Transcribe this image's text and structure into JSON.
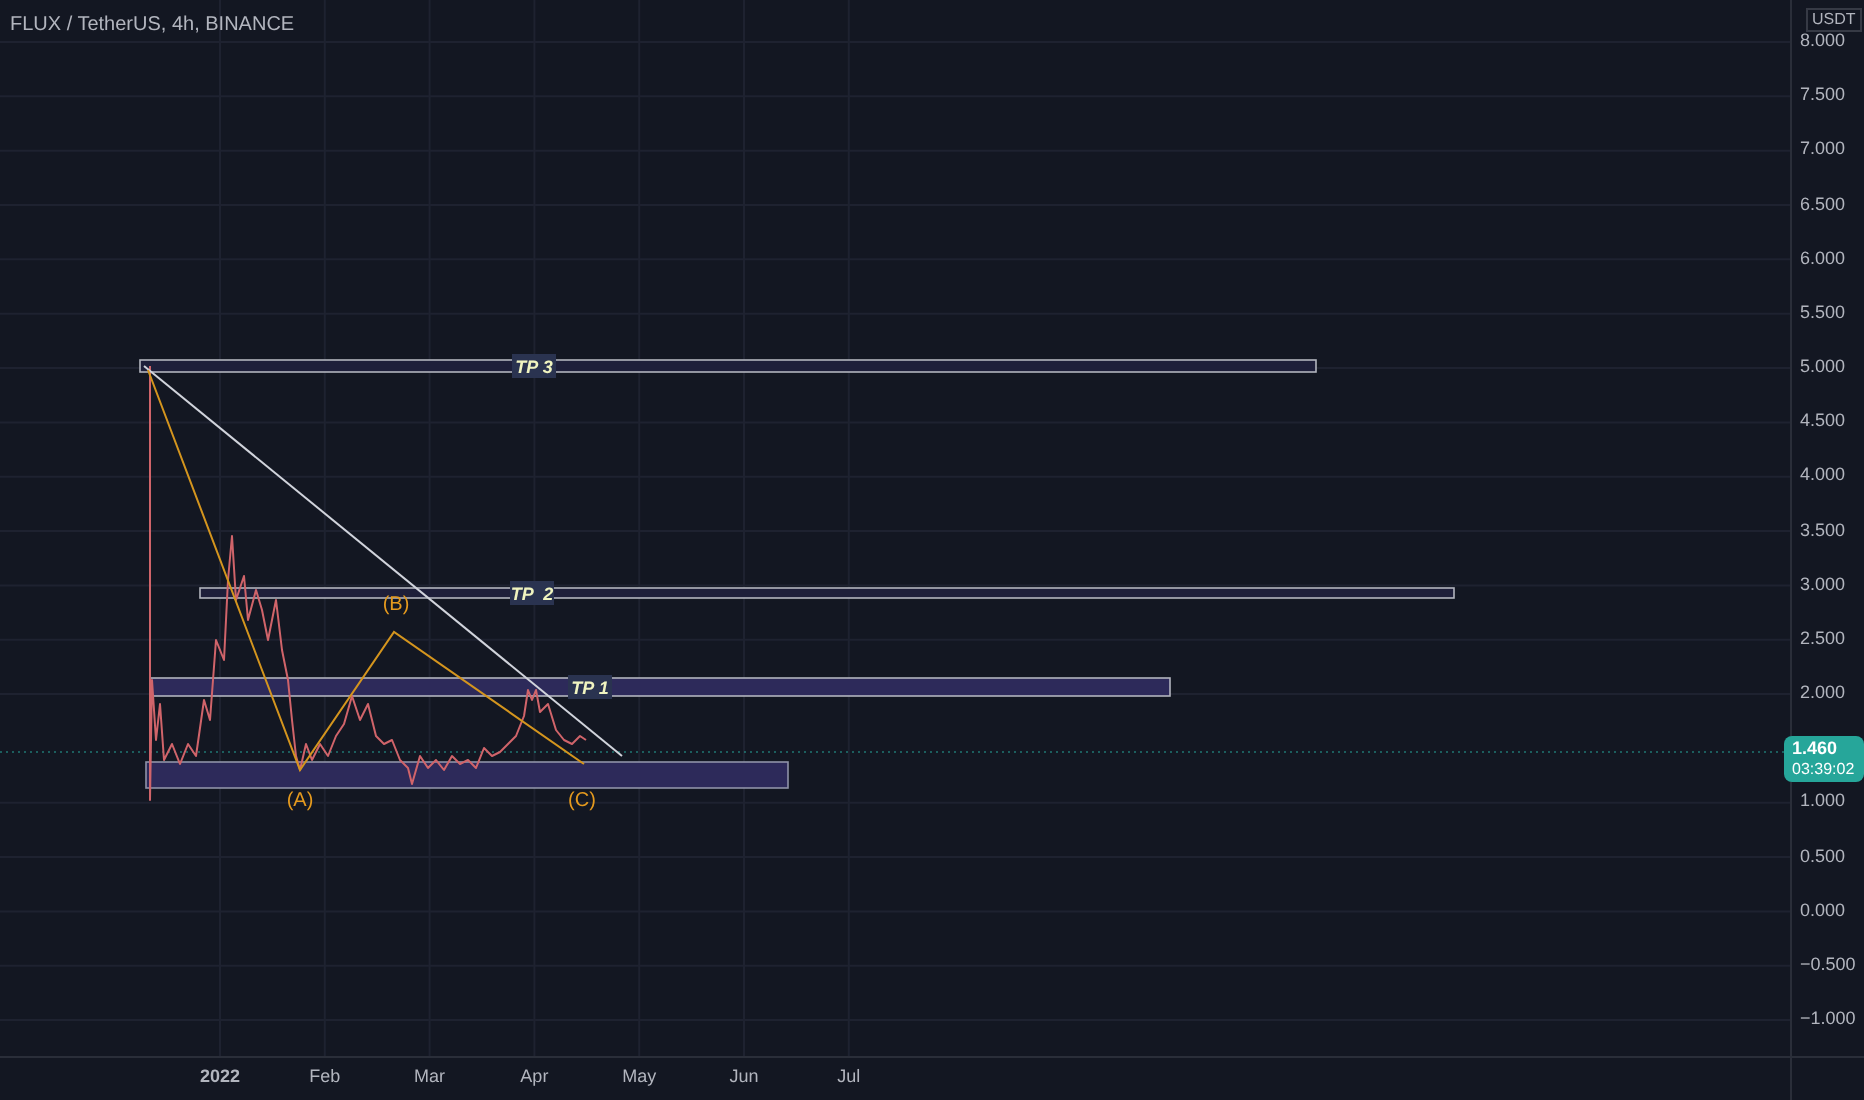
{
  "header": {
    "symbol": "FLUX / TetherUS, 4h, BINANCE"
  },
  "price_axis": {
    "unit": "USDT",
    "labels": [
      "8.000",
      "7.500",
      "7.000",
      "6.500",
      "6.000",
      "5.500",
      "5.000",
      "4.500",
      "4.000",
      "3.500",
      "3.000",
      "2.500",
      "2.000",
      "1.000",
      "0.500",
      "0.000",
      "−0.500",
      "−1.000"
    ],
    "last_price": {
      "price": "1.460",
      "countdown": "03:39:02"
    }
  },
  "time_axis": {
    "labels": [
      "2022",
      "Feb",
      "Mar",
      "Apr",
      "May",
      "Jun",
      "Jul"
    ]
  },
  "drawings": {
    "targets": [
      {
        "label": "TP 3"
      },
      {
        "label": "TP  2"
      },
      {
        "label": "TP 1"
      }
    ],
    "wave_labels": [
      "(A)",
      "(B)",
      "(C)"
    ]
  }
}
